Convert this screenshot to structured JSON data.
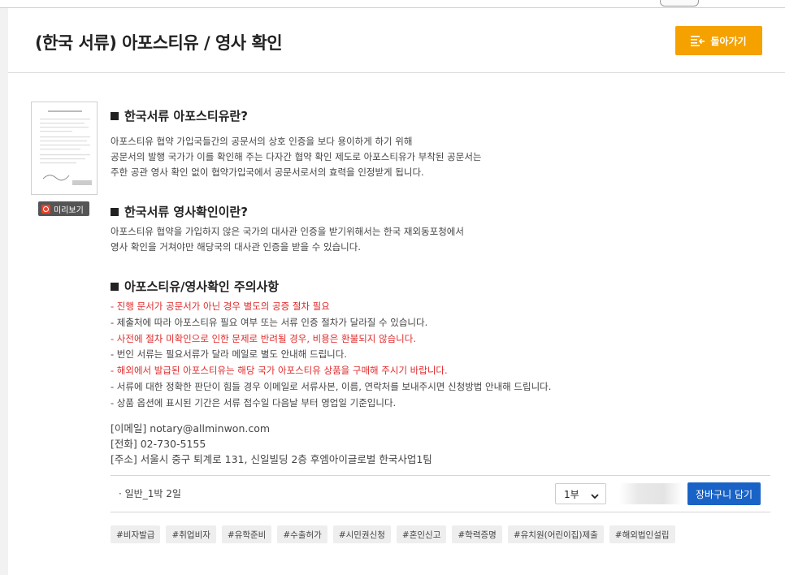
{
  "header": {
    "title": "(한국 서류) 아포스티유 / 영사 확인",
    "back_button": {
      "label": "돌아가기",
      "icon": "list-back-icon"
    }
  },
  "preview": {
    "label": "미리보기",
    "icon": "preview-icon"
  },
  "sections": [
    {
      "title": "한국서류 아포스티유란?",
      "lines": [
        "아포스티유 협약 가입국들간의 공문서의 상호 인증을 보다 용이하게 하기 위해",
        "공문서의 발행 국가가 이를 확인해 주는 다자간 협약 확인 제도로 아포스티유가 부착된 공문서는",
        "주한 공관 영사 확인 없이 협약가입국에서 공문서로서의 효력을 인정받게 됩니다."
      ]
    },
    {
      "title": "한국서류 영사확인이란?",
      "lines": [
        "아포스티유 협약을 가입하지 않은 국가의 대사관 인증을 받기위해서는 한국 재외동포청에서",
        "영사 확인을 거쳐야만 해당국의 대사관 인증을 받을 수 있습니다."
      ]
    },
    {
      "title": "아포스티유/영사확인 주의사항",
      "lines": []
    }
  ],
  "notes": [
    {
      "text": "- 진행 문서가 공문서가 아닌 경우 별도의 공증 절차 필요",
      "highlight": true
    },
    {
      "text": "- 제출처에 따라 아포스티유 필요 여부 또는 서류 인증 절차가 달라질 수 있습니다.",
      "highlight": false
    },
    {
      "text": "- 사전에 절차 미확인으로 인한 문제로 반려될 경우, 비용은 환불되지 않습니다.",
      "highlight": true
    },
    {
      "text": "- 번인 서류는 필요서류가 달라 메일로 별도 안내해 드립니다.",
      "highlight": false
    },
    {
      "text": "- 해외에서 발급된 아포스티유는 해당 국가 아포스티유 상품을 구매해 주시기 바랍니다.",
      "highlight": true
    },
    {
      "text": "- 서류에 대한 정확한 판단이 힘들 경우 이메일로 서류사본, 이름, 연락처를 보내주시면 신청방법 안내해 드립니다.",
      "highlight": false
    },
    {
      "text": "- 상품 옵션에 표시된 기간은 서류 접수일 다음날 부터 영업일 기준입니다.",
      "highlight": false
    }
  ],
  "contact": {
    "email": "[이메일] notary@allminwon.com",
    "phone": "[전화] 02-730-5155",
    "address": "[주소] 서울시 중구 퇴계로 131, 신일빌딩 2층 후엠아이글로벌 한국사업1팀"
  },
  "option": {
    "label": "· 일반_1박 2일",
    "quantity": "1부",
    "cart_button": "장바구니 담기"
  },
  "tags": [
    "#비자발급",
    "#취업비자",
    "#유학준비",
    "#수출허가",
    "#시민권신청",
    "#혼인신고",
    "#학력증명",
    "#유치원(어린이집)제출",
    "#해외법인설립"
  ],
  "colors": {
    "accent_orange": "#f5a100",
    "cart_blue": "#1a63c6",
    "warning_red": "#e02a2a"
  }
}
